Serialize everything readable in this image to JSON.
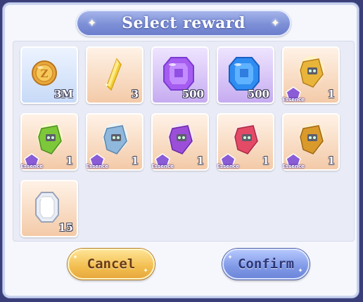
{
  "dialog": {
    "title": "Select reward",
    "cancel_label": "Cancel",
    "confirm_label": "Confirm"
  },
  "rewards": [
    {
      "name": "gold-coin",
      "quantity": "3M",
      "badge": ""
    },
    {
      "name": "yellow-shard",
      "quantity": "3",
      "badge": ""
    },
    {
      "name": "purple-gem",
      "quantity": "500",
      "badge": ""
    },
    {
      "name": "blue-gem",
      "quantity": "500",
      "badge": ""
    },
    {
      "name": "essence-gold",
      "quantity": "1",
      "badge": "Essence"
    },
    {
      "name": "essence-green",
      "quantity": "1",
      "badge": "Essence"
    },
    {
      "name": "essence-blue",
      "quantity": "1",
      "badge": "Essence"
    },
    {
      "name": "essence-purple",
      "quantity": "1",
      "badge": "Essence"
    },
    {
      "name": "essence-red",
      "quantity": "1",
      "badge": "Essence"
    },
    {
      "name": "essence-orange",
      "quantity": "1",
      "badge": "Essence"
    },
    {
      "name": "silver-crystal",
      "quantity": "15",
      "badge": ""
    }
  ],
  "colors": {
    "title_bar": "#7c8fd6",
    "cancel_button": "#f2bd4e",
    "confirm_button": "#7f98e6",
    "essence_badge": "#8a5cd6"
  }
}
